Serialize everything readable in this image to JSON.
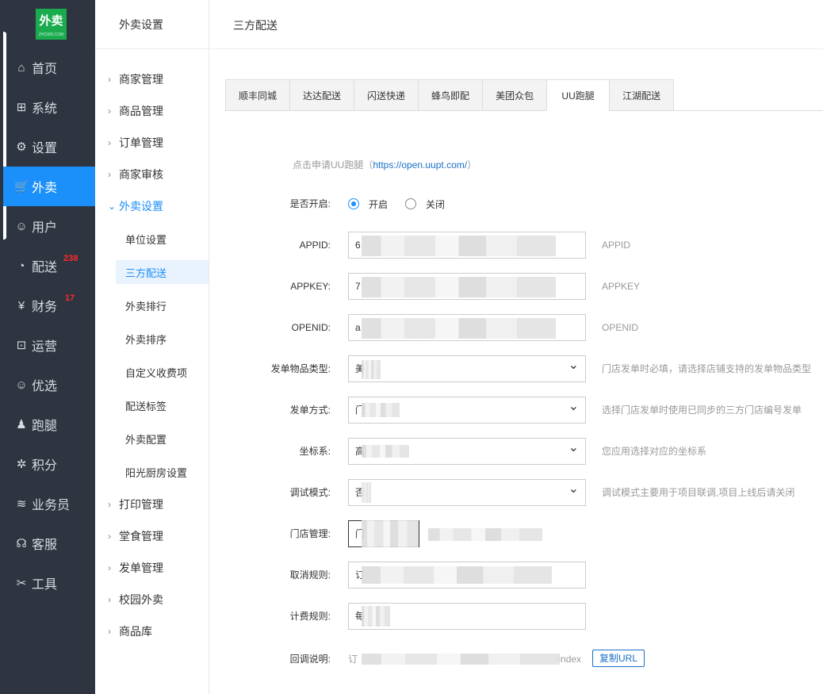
{
  "sidebar": {
    "logo_text": "外卖",
    "logo_sub": "ZHCWS.COM",
    "items": [
      {
        "label": "首页",
        "icon": "home-icon",
        "glyph": "⌂"
      },
      {
        "label": "系统",
        "icon": "windows-icon",
        "glyph": "⊞"
      },
      {
        "label": "设置",
        "icon": "gear-icon",
        "glyph": "⚙"
      },
      {
        "label": "外卖",
        "icon": "cart-icon",
        "glyph": "🛒"
      },
      {
        "label": "用户",
        "icon": "user-icon",
        "glyph": "☺"
      },
      {
        "label": "配送",
        "icon": "dashboard-icon",
        "glyph": "◔",
        "badge": "238"
      },
      {
        "label": "财务",
        "icon": "yen-icon",
        "glyph": "¥",
        "badge": "17"
      },
      {
        "label": "运营",
        "icon": "gift-icon",
        "glyph": "⊡"
      },
      {
        "label": "优选",
        "icon": "smile-icon",
        "glyph": "☺"
      },
      {
        "label": "跑腿",
        "icon": "person-icon",
        "glyph": "♟"
      },
      {
        "label": "积分",
        "icon": "palm-icon",
        "glyph": "✲"
      },
      {
        "label": "业务员",
        "icon": "layers-icon",
        "glyph": "≋"
      },
      {
        "label": "客服",
        "icon": "headset-icon",
        "glyph": "☊"
      },
      {
        "label": "工具",
        "icon": "tools-icon",
        "glyph": "✂"
      }
    ]
  },
  "subnav": {
    "title": "外卖设置",
    "groups": [
      {
        "label": "商家管理"
      },
      {
        "label": "商品管理"
      },
      {
        "label": "订单管理"
      },
      {
        "label": "商家审核"
      },
      {
        "label": "外卖设置",
        "open": true,
        "children": [
          {
            "label": "单位设置"
          },
          {
            "label": "三方配送",
            "active": true
          },
          {
            "label": "外卖排行"
          },
          {
            "label": "外卖排序"
          },
          {
            "label": "自定义收费项"
          },
          {
            "label": "配送标签"
          },
          {
            "label": "外卖配置"
          },
          {
            "label": "阳光厨房设置"
          }
        ]
      },
      {
        "label": "打印管理"
      },
      {
        "label": "堂食管理"
      },
      {
        "label": "发单管理"
      },
      {
        "label": "校园外卖"
      },
      {
        "label": "商品库"
      }
    ]
  },
  "header": {
    "title": "三方配送"
  },
  "tabs": [
    "顺丰同城",
    "达达配送",
    "闪送快递",
    "蜂鸟即配",
    "美团众包",
    "UU跑腿",
    "江湖配送"
  ],
  "active_tab": "UU跑腿",
  "form": {
    "apply_hint_prefix": "点击申请UU跑腿（",
    "apply_link": "https://open.uupt.com/",
    "apply_hint_suffix": "）",
    "enabled": {
      "label": "是否开启:",
      "on": "开启",
      "off": "关闭",
      "value": "开启"
    },
    "appid": {
      "label": "APPID:",
      "value": "6",
      "help": "APPID"
    },
    "appkey": {
      "label": "APPKEY:",
      "value": "7",
      "help": "APPKEY"
    },
    "openid": {
      "label": "OPENID:",
      "value": "a",
      "help": "OPENID"
    },
    "goods_type": {
      "label": "发单物品类型:",
      "value": "美",
      "help": "门店发单时必填，请选择店铺支持的发单物品类型"
    },
    "send_mode": {
      "label": "发单方式:",
      "value": "门",
      "help": "选择门店发单时使用已同步的三方门店编号发单"
    },
    "coord": {
      "label": "坐标系:",
      "value": "高",
      "help": "您应用选择对应的坐标系"
    },
    "debug": {
      "label": "调试模式:",
      "value": "否",
      "help": "调试模式主要用于项目联调,项目上线后请关闭"
    },
    "store": {
      "label": "门店管理:",
      "value": "门"
    },
    "cancel_rule": {
      "label": "取消规则:",
      "value": "订"
    },
    "fee_rule": {
      "label": "计费规则:",
      "value": "每"
    },
    "callback": {
      "label": "回调说明:",
      "value_prefix": "订",
      "value_suffix": "/index",
      "copy": "复制URL"
    }
  }
}
